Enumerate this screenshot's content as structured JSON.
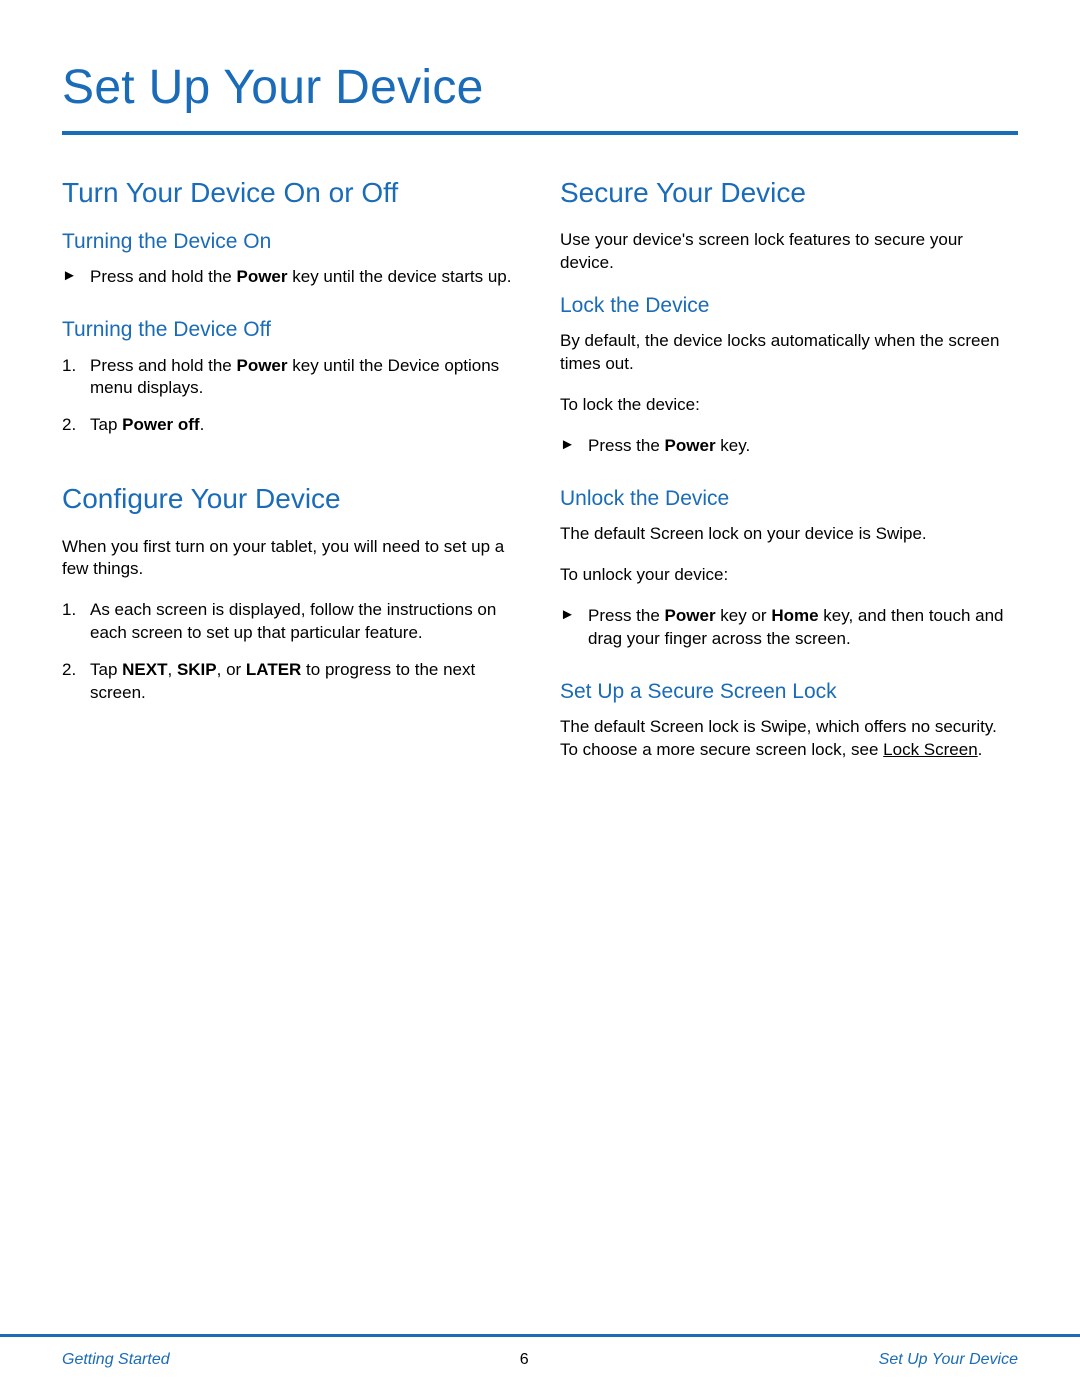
{
  "title": "Set Up Your Device",
  "left": {
    "section1": {
      "heading": "Turn Your Device On or Off",
      "sub1": {
        "heading": "Turning the Device On",
        "item1": {
          "pre": "Press and hold the ",
          "bold": "Power",
          "post": " key until the device starts up."
        }
      },
      "sub2": {
        "heading": "Turning the Device Off",
        "item1": {
          "pre": "Press and hold the ",
          "bold": "Power",
          "post": " key until the Device options menu displays."
        },
        "item2": {
          "pre": "Tap ",
          "bold": "Power off",
          "post": "."
        }
      }
    },
    "section2": {
      "heading": "Configure Your Device",
      "intro": "When you first turn on your tablet, you will need to set up a few things.",
      "item1": "As each screen is displayed, follow the instructions on each screen to set up that particular feature.",
      "item2": {
        "pre": "Tap ",
        "b1": "NEXT",
        "sep1": ", ",
        "b2": "SKIP",
        "sep2": ", or ",
        "b3": "LATER",
        "post": " to progress to the next screen."
      }
    }
  },
  "right": {
    "section1": {
      "heading": "Secure Your Device",
      "intro": "Use your device's screen lock features to secure your device.",
      "sub1": {
        "heading": "Lock the Device",
        "para": "By default, the device locks automatically when the screen times out.",
        "lead": "To lock the device:",
        "item1": {
          "pre": "Press the ",
          "bold": "Power",
          "post": " key."
        }
      },
      "sub2": {
        "heading": "Unlock the Device",
        "para": "The default Screen lock on your device is Swipe.",
        "lead": "To unlock your device:",
        "item1": {
          "pre": "Press the ",
          "b1": "Power",
          "mid": " key or ",
          "b2": "Home",
          "post": " key, and then touch and drag your finger across the screen."
        }
      },
      "sub3": {
        "heading": "Set Up a Secure Screen Lock",
        "para": {
          "pre": "The default Screen lock is Swipe, which offers no security. To choose a more secure screen lock, see ",
          "link": "Lock Screen",
          "post": "."
        }
      }
    }
  },
  "footer": {
    "left": "Getting Started",
    "center": "6",
    "right": "Set Up Your Device"
  }
}
